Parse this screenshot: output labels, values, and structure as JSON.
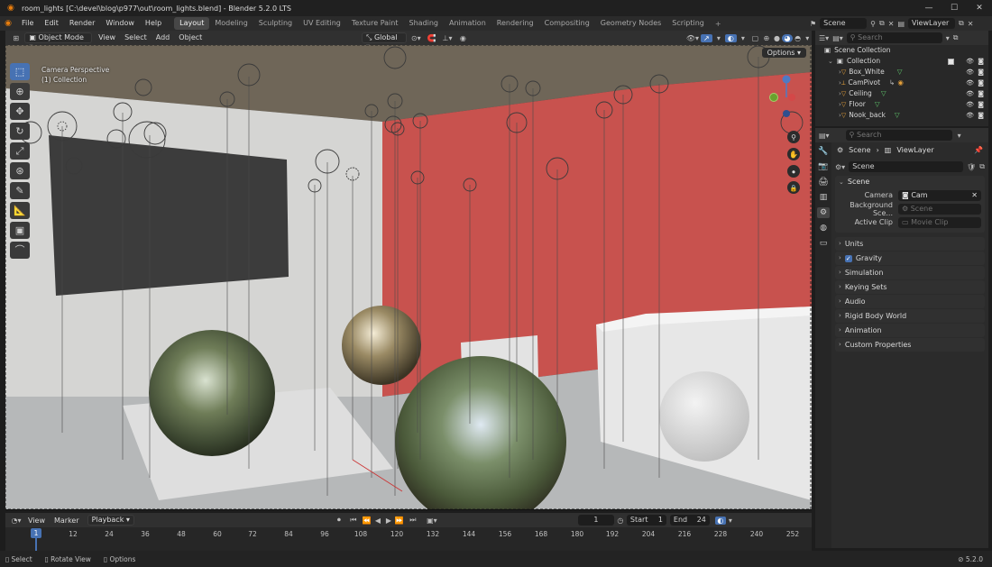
{
  "window": {
    "title": "room_lights [C:\\devel\\blog\\p977\\out\\room_lights.blend] - Blender 5.2.0 LTS"
  },
  "menu": [
    "File",
    "Edit",
    "Render",
    "Window",
    "Help"
  ],
  "workspaces": [
    "Layout",
    "Modeling",
    "Sculpting",
    "UV Editing",
    "Texture Paint",
    "Shading",
    "Animation",
    "Rendering",
    "Compositing",
    "Geometry Nodes",
    "Scripting"
  ],
  "active_workspace": "Layout",
  "top_right": {
    "scene": "Scene",
    "view_layer": "ViewLayer"
  },
  "viewport_header": {
    "mode": "Object Mode",
    "items": [
      "View",
      "Select",
      "Add",
      "Object"
    ],
    "orientation": "Global"
  },
  "viewport": {
    "perspective": "Camera Perspective",
    "collection": "(1) Collection",
    "options": "Options"
  },
  "outliner": {
    "search_placeholder": "Search",
    "root": "Scene Collection",
    "collection": "Collection",
    "items": [
      "Box_White",
      "CamPivot",
      "Ceiling",
      "Floor",
      "Nook_back"
    ]
  },
  "properties": {
    "search_placeholder": "Search",
    "breadcrumb": [
      "Scene",
      "ViewLayer"
    ],
    "datablock": "Scene",
    "scene_panel": {
      "title": "Scene",
      "camera_label": "Camera",
      "camera_value": "Cam",
      "background_label": "Background Sce...",
      "background_value": "Scene",
      "clip_label": "Active Clip",
      "clip_value": "Movie Clip"
    },
    "subpanels": [
      "Units",
      "Gravity",
      "Simulation",
      "Keying Sets",
      "Audio",
      "Rigid Body World",
      "Animation",
      "Custom Properties"
    ]
  },
  "timeline": {
    "items": [
      "View",
      "Marker"
    ],
    "playback": "Playback",
    "current_frame": "1",
    "start_label": "Start",
    "start": "1",
    "end_label": "End",
    "end": "24",
    "ticks": [
      "1",
      "12",
      "24",
      "36",
      "48",
      "60",
      "72",
      "84",
      "96",
      "108",
      "120",
      "132",
      "144",
      "156",
      "168",
      "180",
      "192",
      "204",
      "216",
      "228",
      "240",
      "252"
    ]
  },
  "statusbar": {
    "select": "Select",
    "rotate": "Rotate View",
    "options": "Options",
    "version": "5.2.0"
  },
  "colors": {
    "accent": "#4772b3",
    "red_wall": "#c8524e",
    "logo": "#e87d0d"
  }
}
